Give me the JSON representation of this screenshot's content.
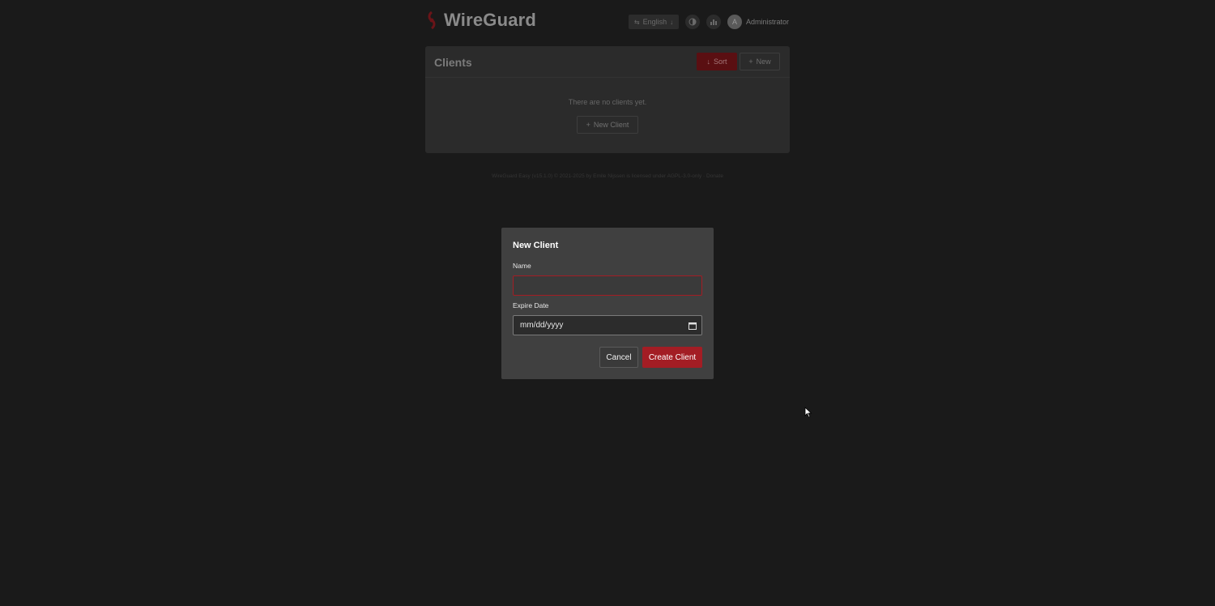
{
  "app": {
    "title": "WireGuard",
    "language": "English",
    "user_initial": "A",
    "user_name": "Administrator"
  },
  "clients_panel": {
    "title": "Clients",
    "sort_label": "Sort",
    "new_label": "New",
    "empty_text": "There are no clients yet.",
    "new_client_label": "New Client"
  },
  "footer": {
    "text": "WireGuard Easy (v15.1.0) © 2021-2025 by Emile Nijssen is licensed under AGPL-3.0-only · Donate"
  },
  "modal": {
    "title": "New Client",
    "name_label": "Name",
    "name_value": "",
    "expire_label": "Expire Date",
    "expire_placeholder": "mm/dd/yyyy",
    "cancel_label": "Cancel",
    "create_label": "Create Client"
  },
  "colors": {
    "background": "#1a1a1a",
    "accent": "#a31d24",
    "modal_bg": "#404040"
  },
  "icons": [
    "wireguard-logo-icon",
    "translate-icon",
    "chevron-down-icon",
    "contrast-icon",
    "chart-icon",
    "arrow-down-icon",
    "plus-icon",
    "calendar-icon",
    "cursor-icon"
  ]
}
